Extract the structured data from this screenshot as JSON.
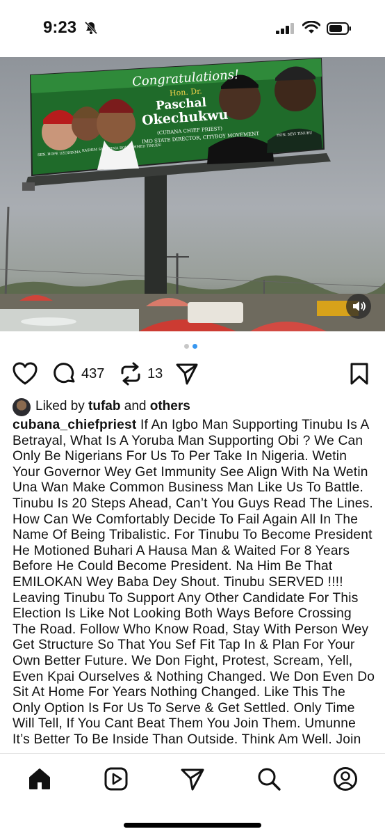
{
  "status_bar": {
    "time": "9:23",
    "icons": [
      "bell-slash-icon",
      "signal-icon",
      "wifi-icon",
      "battery-icon"
    ]
  },
  "post_image": {
    "billboard": {
      "headline": "Congratulations!",
      "honorific": "Hon. Dr.",
      "name_line1": "Paschal",
      "name_line2": "Okechukwu",
      "alias": "(CUBANA CHIEF PRIEST)",
      "role": "IMO STATE DIRECTOR, CITYBOY MOVEMENT",
      "caption_left_1": "SEN. HOPE UZODINMA",
      "caption_left_2": "KASHIM SHETTIMA",
      "caption_left_3": "BOLA AHMED TINUBU",
      "caption_right": "HON. SEYI TINUBU"
    },
    "carousel_total": 2,
    "carousel_active": 2
  },
  "actions": {
    "comment_count": "437",
    "repost_count": "13"
  },
  "likes": {
    "prefix": "Liked by ",
    "user": "tufab",
    "middle": " and ",
    "others": "others"
  },
  "caption": {
    "username": "cubana_chiefpriest",
    "text": " If An Igbo Man Supporting Tinubu Is A Betrayal, What Is A Yoruba Man Supporting Obi ? We Can Only Be Nigerians For Us To Per Take In Nigeria. Wetin Your Governor Wey Get Immunity See Align With Na Wetin Una Wan Make Common Business Man Like Us To Battle. Tinubu Is 20 Steps Ahead, Can’t You Guys Read The Lines. How Can We Comfortably Decide To Fail Again All In The Name Of Being Tribalistic. For Tinubu To Become President He Motioned Buhari A Hausa Man & Waited For 8 Years Before He Could Become President. Na Him Be That EMILOKAN Wey Baba Dey Shout. Tinubu SERVED !!!! Leaving Tinubu To Support Any Other Candidate For This Election Is Like Not Looking Both Ways Before Crossing The Road. Follow Who Know Road, Stay With Person Wey Get Structure So That You Sef  Fit Tap In & Plan For Your Own Better Future. We Don Fight, Protest, Scream, Yell, Even Kpai Ourselves & Nothing Changed. We Don Even Do Sit At Home For Years Nothing Changed. Like This The Only Option Is For Us To Serve & Get Settled. Only Time Will Tell, If You Cant Beat Them You Join Them. Umunne It’s Better To Be Inside Than Outside. Think  Am Well. Join"
  },
  "nav": {
    "items": [
      "home-icon",
      "reels-icon",
      "send-icon",
      "search-icon",
      "profile-icon"
    ]
  },
  "colors": {
    "billboard_green": "#1f6b2a",
    "text": "#111111",
    "dot_active": "#3897f0",
    "dot_inactive": "#c7c7c7"
  }
}
